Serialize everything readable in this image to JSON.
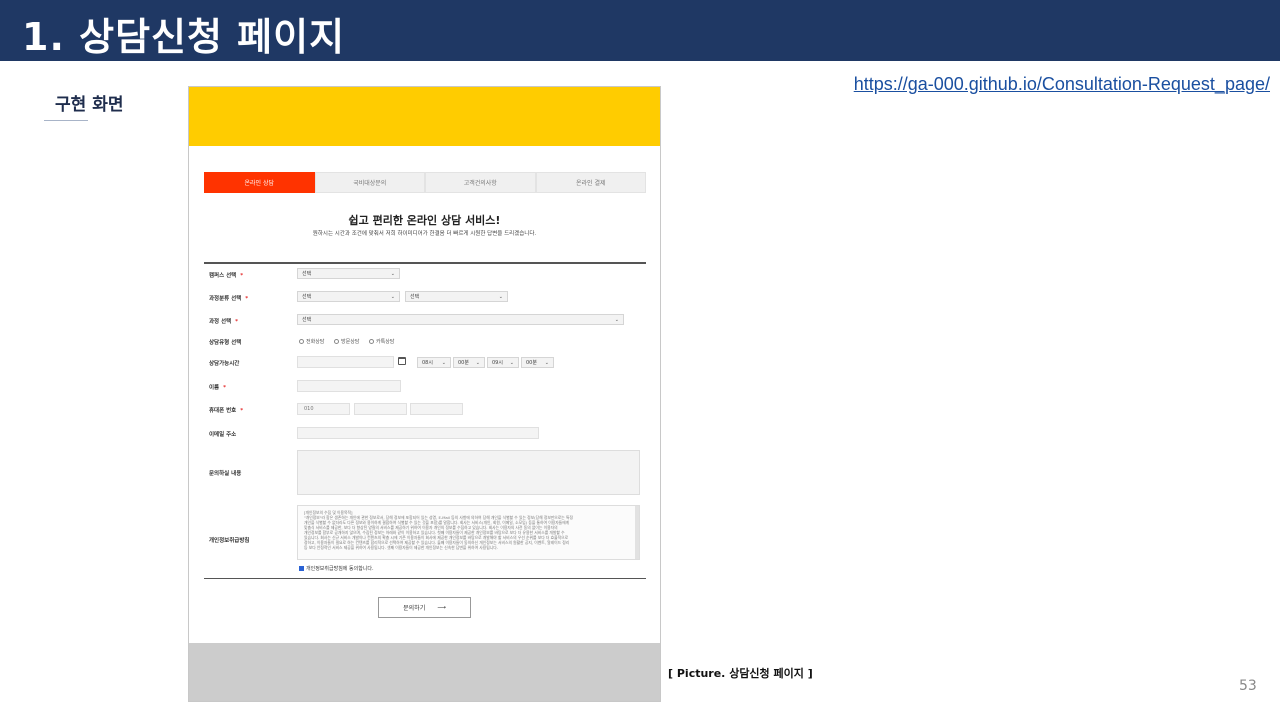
{
  "slide": {
    "title": "1. 상담신청 페이지",
    "section_label": "구현 화면",
    "url": "https://ga-000.github.io/Consultation-Request_page/",
    "caption": "[ Picture. 상담신청 페이지 ]",
    "page_number": "53"
  },
  "mockup": {
    "tabs": [
      "온라인 상담",
      "국비대상문의",
      "고객건의사항",
      "온라인 결제"
    ],
    "active_tab_index": 0,
    "hero_title": "쉽고 편리한 온라인 상담 서비스!",
    "hero_subtitle": "원하시는 시간과 조건에 맞춰서 저희 하이미디어가 한결음 더 빠르게 시원한 답변을 드리겠습니다.",
    "form": {
      "campus_label": "캠퍼스 선택",
      "course_category_label": "과정분류 선택",
      "course_label": "과정 선택",
      "consult_type_label": "상담유형 선택",
      "available_time_label": "상담가능시간",
      "name_label": "이름",
      "phone_label": "휴대폰 번호",
      "email_label": "이메일 주소",
      "inquiry_label": "문의하실 내용",
      "policy_label": "개인정보취급방침",
      "select_placeholder": "선택",
      "radio_options": [
        "전화상담",
        "방문상담",
        "카톡상담"
      ],
      "time_selects": [
        "08시",
        "00분",
        "09시",
        "00분"
      ],
      "phone_prefix": "010",
      "policy_text": [
        "[개인정보의 수집 및 이용목적]",
        "\"개인정보\"라 함은 생존하는 개인에 관한 정보로서, 당해 정보에 포함되어 있는 성명, E-Mail 등의 사항에 의하여 당해 개인을 식별할 수 있는 정보(당해 정보만으로는 특정",
        "개인을 식별할 수 없더라도 다른 정보와 용이하게 결합하여 식별할 수 있는 것을 포함)를 말합니다. 회사는 서비스(개인, 회원, 이메일, 소모임) 등을 통하여 이용자들에게",
        "맞춤식 서비스를 제공한, 보다 더 향상된 양질의 서비스를 제공하기 위하여 이용자 개인의 정보를 수집하고 있습니다. 회사는 이용자의 사전 동의 없이는 이용자의",
        "개인정보를 함부로 공개하지 않으며, 수집된 정보는 아래와 같이 이용하고 있습니다. 첫째 이용자들이 제공한 개인정보를 바탕으로 보다 더 유용한 서비스를 개발할 수",
        "있습니다. 회사는 신규 서비스 개발이나 컨텐츠의 확충 시에 기존 이용자들이 회사에 제공한 개인정보를 바탕으로 개발해야 할 서비스의 우선 순위를 보다 더 효율적으로",
        "정하고, 이용자들이 필요로 하는 컨텐츠를 합리적으로 선택하여 제공할 수 있습니다. 둘째 이용자들이 동의하신 개인정보는 서비스의 원활한 공지, 이벤트, 알레이드 정리",
        "등 보다 안정적인 서비스 제공을 위하여 사용됩니다. 셋째 이용자들이 제공한 개인정보는 신속한 답변을 위하여 사용됩니다."
      ],
      "agree_text": "개인정보취급방침에 동의합니다.",
      "submit_label": "문의하기",
      "submit_arrow": "⟶"
    }
  },
  "colors": {
    "title_bar": "#1f3864",
    "header_band": "#ffcc00",
    "footer_band": "#cccccc",
    "active_tab": "#ff3300",
    "required_mark": "#e62e2e"
  }
}
